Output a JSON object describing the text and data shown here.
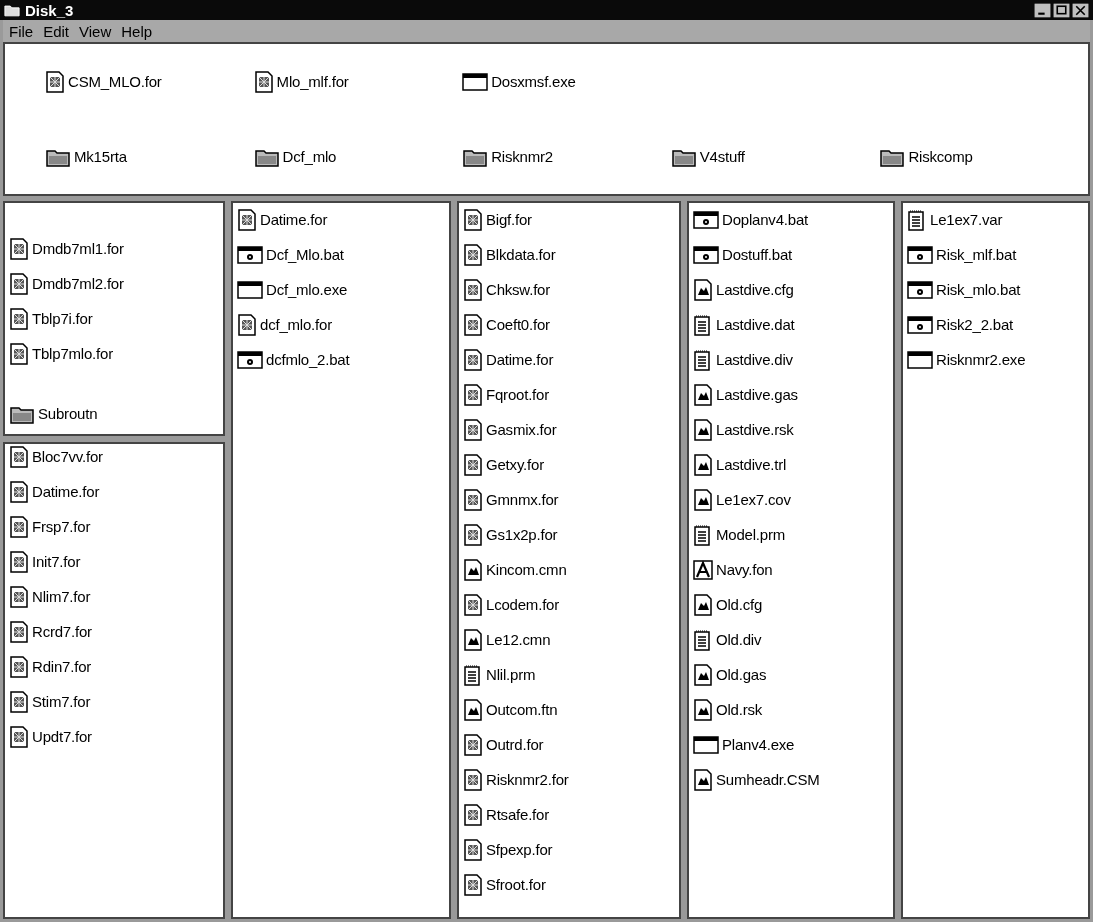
{
  "window": {
    "title": "Disk_3"
  },
  "menu": [
    {
      "label": "File"
    },
    {
      "label": "Edit"
    },
    {
      "label": "View"
    },
    {
      "label": "Help"
    }
  ],
  "top_pane": {
    "files": [
      {
        "name": "CSM_MLO.for",
        "kind": "fortran"
      },
      {
        "name": "Mlo_mlf.for",
        "kind": "fortran"
      },
      {
        "name": "Dosxmsf.exe",
        "kind": "exe"
      }
    ],
    "folders": [
      {
        "name": "Mk15rta",
        "kind": "folder"
      },
      {
        "name": "Dcf_mlo",
        "kind": "folder"
      },
      {
        "name": "Risknmr2",
        "kind": "folder"
      },
      {
        "name": "V4stuff",
        "kind": "folder"
      },
      {
        "name": "Riskcomp",
        "kind": "folder"
      }
    ]
  },
  "columns": [
    {
      "panes": [
        {
          "files": [
            {
              "name": "Dmdb7ml1.for",
              "kind": "fortran"
            },
            {
              "name": "Dmdb7ml2.for",
              "kind": "fortran"
            },
            {
              "name": "Tblp7i.for",
              "kind": "fortran"
            },
            {
              "name": "Tblp7mlo.for",
              "kind": "fortran"
            }
          ],
          "folders": [
            {
              "name": "Subroutn",
              "kind": "folder"
            }
          ]
        },
        {
          "files": [
            {
              "name": "Bloc7vv.for",
              "kind": "fortran"
            },
            {
              "name": "Datime.for",
              "kind": "fortran"
            },
            {
              "name": "Frsp7.for",
              "kind": "fortran"
            },
            {
              "name": "Init7.for",
              "kind": "fortran"
            },
            {
              "name": "Nlim7.for",
              "kind": "fortran"
            },
            {
              "name": "Rcrd7.for",
              "kind": "fortran"
            },
            {
              "name": "Rdin7.for",
              "kind": "fortran"
            },
            {
              "name": "Stim7.for",
              "kind": "fortran"
            },
            {
              "name": "Updt7.for",
              "kind": "fortran"
            }
          ]
        }
      ]
    },
    {
      "panes": [
        {
          "files": [
            {
              "name": "Datime.for",
              "kind": "fortran"
            },
            {
              "name": "Dcf_Mlo.bat",
              "kind": "batch"
            },
            {
              "name": "Dcf_mlo.exe",
              "kind": "exe"
            },
            {
              "name": "dcf_mlo.for",
              "kind": "fortran"
            },
            {
              "name": "dcfmlo_2.bat",
              "kind": "batch"
            }
          ]
        }
      ]
    },
    {
      "panes": [
        {
          "files": [
            {
              "name": "Bigf.for",
              "kind": "fortran"
            },
            {
              "name": "Blkdata.for",
              "kind": "fortran"
            },
            {
              "name": "Chksw.for",
              "kind": "fortran"
            },
            {
              "name": "Coeft0.for",
              "kind": "fortran"
            },
            {
              "name": "Datime.for",
              "kind": "fortran"
            },
            {
              "name": "Fqroot.for",
              "kind": "fortran"
            },
            {
              "name": "Gasmix.for",
              "kind": "fortran"
            },
            {
              "name": "Getxy.for",
              "kind": "fortran"
            },
            {
              "name": "Gmnmx.for",
              "kind": "fortran"
            },
            {
              "name": "Gs1x2p.for",
              "kind": "fortran"
            },
            {
              "name": "Kincom.cmn",
              "kind": "data"
            },
            {
              "name": "Lcodem.for",
              "kind": "fortran"
            },
            {
              "name": "Le12.cmn",
              "kind": "data"
            },
            {
              "name": "Nlil.prm",
              "kind": "text"
            },
            {
              "name": "Outcom.ftn",
              "kind": "data"
            },
            {
              "name": "Outrd.for",
              "kind": "fortran"
            },
            {
              "name": "Risknmr2.for",
              "kind": "fortran"
            },
            {
              "name": "Rtsafe.for",
              "kind": "fortran"
            },
            {
              "name": "Sfpexp.for",
              "kind": "fortran"
            },
            {
              "name": "Sfroot.for",
              "kind": "fortran"
            }
          ]
        }
      ]
    },
    {
      "panes": [
        {
          "files": [
            {
              "name": "Doplanv4.bat",
              "kind": "batch"
            },
            {
              "name": "Dostuff.bat",
              "kind": "batch"
            },
            {
              "name": "Lastdive.cfg",
              "kind": "data"
            },
            {
              "name": "Lastdive.dat",
              "kind": "text"
            },
            {
              "name": "Lastdive.div",
              "kind": "text"
            },
            {
              "name": "Lastdive.gas",
              "kind": "data"
            },
            {
              "name": "Lastdive.rsk",
              "kind": "data"
            },
            {
              "name": "Lastdive.trl",
              "kind": "data"
            },
            {
              "name": "Le1ex7.cov",
              "kind": "data"
            },
            {
              "name": "Model.prm",
              "kind": "text"
            },
            {
              "name": "Navy.fon",
              "kind": "font"
            },
            {
              "name": "Old.cfg",
              "kind": "data"
            },
            {
              "name": "Old.div",
              "kind": "text"
            },
            {
              "name": "Old.gas",
              "kind": "data"
            },
            {
              "name": "Old.rsk",
              "kind": "data"
            },
            {
              "name": "Planv4.exe",
              "kind": "exe"
            },
            {
              "name": "Sumheadr.CSM",
              "kind": "data"
            }
          ]
        }
      ]
    },
    {
      "panes": [
        {
          "files": [
            {
              "name": "Le1ex7.var",
              "kind": "text"
            },
            {
              "name": "Risk_mlf.bat",
              "kind": "batch"
            },
            {
              "name": "Risk_mlo.bat",
              "kind": "batch"
            },
            {
              "name": "Risk2_2.bat",
              "kind": "batch"
            },
            {
              "name": "Risknmr2.exe",
              "kind": "exe"
            }
          ]
        }
      ]
    }
  ]
}
